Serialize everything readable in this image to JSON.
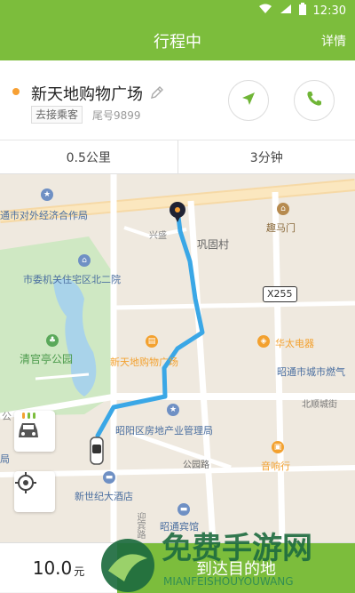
{
  "status_bar": {
    "time": "12:30"
  },
  "header": {
    "title": "行程中",
    "detail_label": "详情"
  },
  "trip": {
    "destination": "新天地购物广场",
    "pickup_tag": "去接乘客",
    "tail_number": "尾号9899"
  },
  "metrics": {
    "distance": "0.5公里",
    "time": "3分钟"
  },
  "map": {
    "road_badge": "X255",
    "labels": {
      "economic_bureau": "通市对外经济合作局",
      "quma_gate": "趣马门",
      "xingsheng": "兴盛",
      "gonggu_village": "巩固村",
      "housing_area": "市委机关住宅区北二院",
      "qingguanting_park": "清官亭公园",
      "xintiandi_mall": "新天地购物广场",
      "huatai_electric": "华太电器",
      "zhaotong_city": "昭通市城市燃气",
      "beiguan_road": "北顺城街",
      "real_estate_bureau": "昭阳区房地产业管理局",
      "gongyuan_road": "公园路",
      "yinxiang_street": "音响行",
      "new_century_hotel": "新世纪大酒店",
      "zhaotong_hotel": "昭通宾馆",
      "ju_label": "局",
      "gong_road": "公",
      "yingbin_road": "迎宾路"
    }
  },
  "bottom": {
    "fare_value": "10.0",
    "fare_unit": "元",
    "arrive_label": "到达目的地"
  },
  "watermark": {
    "text": "免费手游网",
    "sub": "MIANFEISHOUYOUWANG"
  },
  "colors": {
    "brand_green": "#7cbd3c",
    "route_blue": "#3aa7e6",
    "dest_orange": "#f7a033"
  }
}
